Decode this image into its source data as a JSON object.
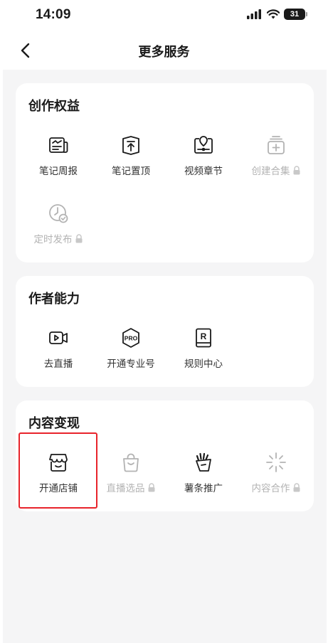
{
  "status_bar": {
    "time": "14:09",
    "battery": "31"
  },
  "nav": {
    "title": "更多服务"
  },
  "sections": [
    {
      "title": "创作权益",
      "items": [
        {
          "label": "笔记周报",
          "icon": "weekly-report-icon",
          "locked": false
        },
        {
          "label": "笔记置顶",
          "icon": "pin-top-icon",
          "locked": false
        },
        {
          "label": "视频章节",
          "icon": "video-chapter-icon",
          "locked": false
        },
        {
          "label": "创建合集",
          "icon": "create-collection-icon",
          "locked": true
        },
        {
          "label": "定时发布",
          "icon": "scheduled-publish-icon",
          "locked": true
        }
      ]
    },
    {
      "title": "作者能力",
      "items": [
        {
          "label": "去直播",
          "icon": "live-stream-icon",
          "locked": false
        },
        {
          "label": "开通专业号",
          "icon": "pro-badge-icon",
          "locked": false
        },
        {
          "label": "规则中心",
          "icon": "rules-book-icon",
          "locked": false
        }
      ]
    },
    {
      "title": "内容变现",
      "items": [
        {
          "label": "开通店铺",
          "icon": "shop-icon",
          "locked": false
        },
        {
          "label": "直播选品",
          "icon": "shopping-bag-icon",
          "locked": true
        },
        {
          "label": "薯条推广",
          "icon": "fries-promote-icon",
          "locked": false
        },
        {
          "label": "内容合作",
          "icon": "sparkle-collab-icon",
          "locked": true
        }
      ]
    }
  ],
  "colors": {
    "accent_highlight": "#e8232b",
    "page_bg": "#f5f5f6",
    "card_bg": "#ffffff",
    "disabled_text": "#b3b3b3"
  }
}
